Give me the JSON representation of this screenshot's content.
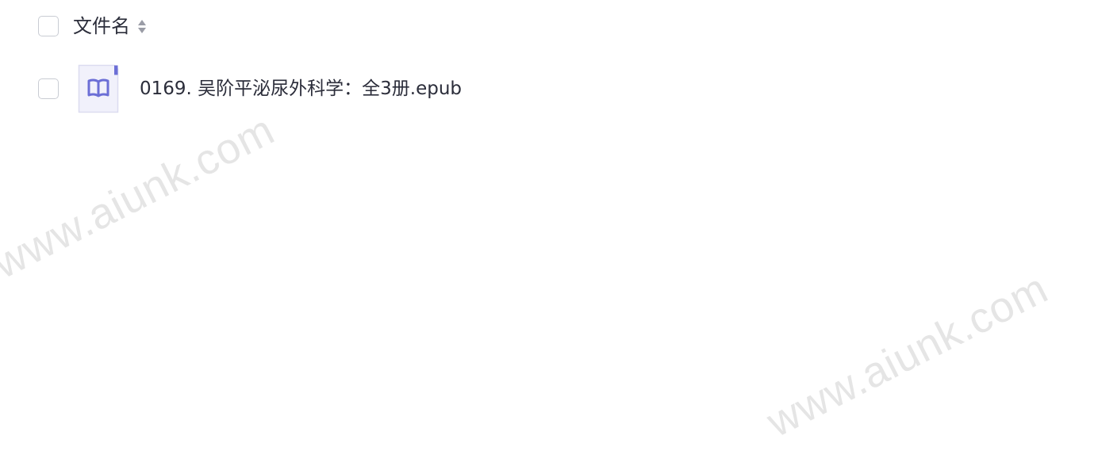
{
  "header": {
    "column_label": "文件名",
    "sort_icon": "sort-both-icon"
  },
  "files": [
    {
      "name": "0169. 吴阶平泌尿外科学：全3册.epub",
      "icon": "book-icon",
      "icon_color": "#6c6fd6"
    }
  ],
  "watermark": {
    "text": "www.aiunk.com"
  },
  "colors": {
    "text": "#2b2d3a",
    "checkbox_border": "#c9ccd3",
    "file_icon_bg": "#f1f1fb",
    "file_icon_accent": "#6c6fd6"
  }
}
